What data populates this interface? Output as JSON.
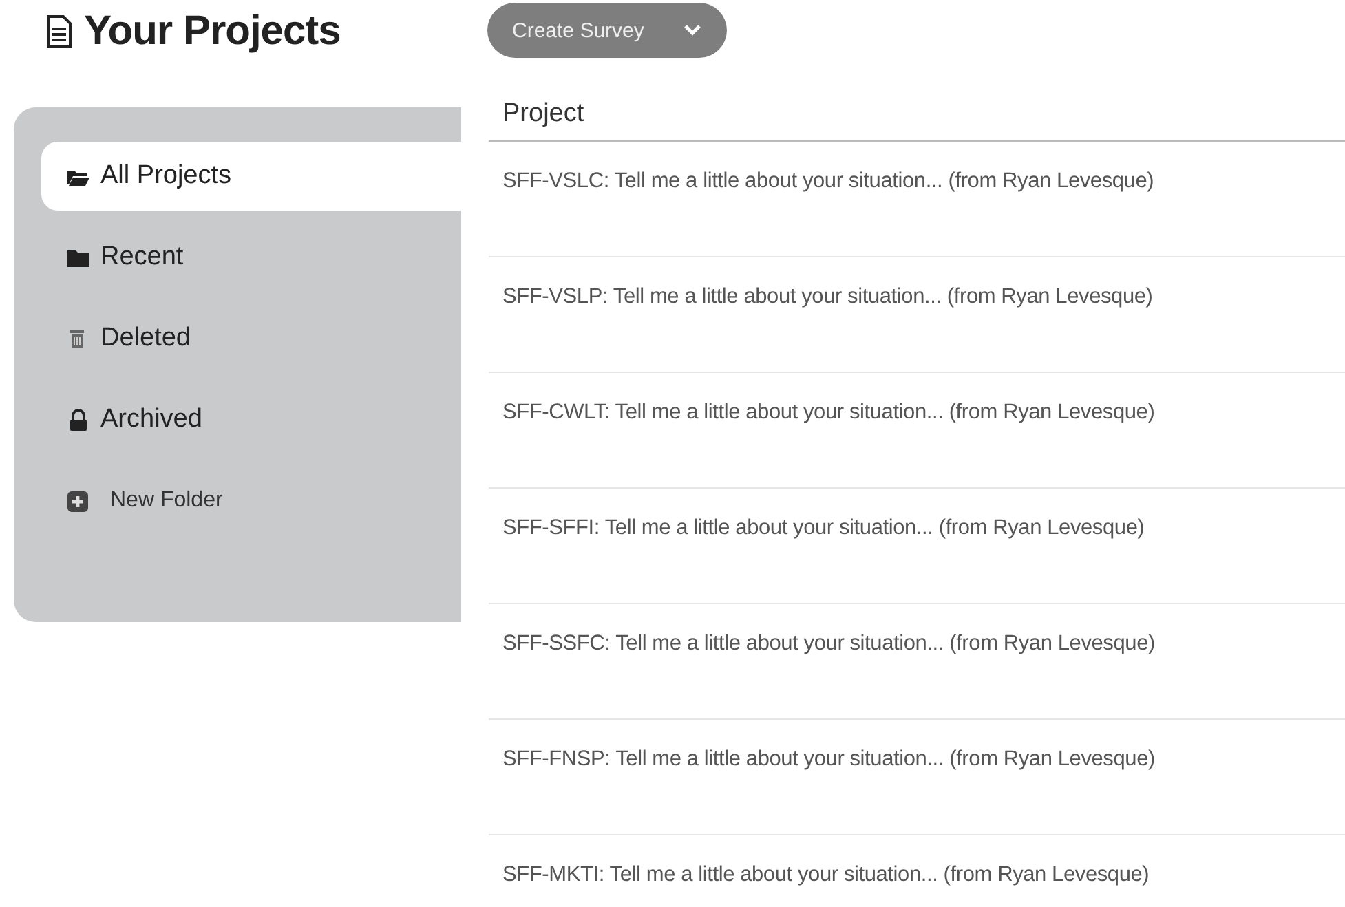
{
  "header": {
    "title": "Your Projects",
    "create_button": "Create Survey"
  },
  "sidebar": {
    "items": [
      {
        "label": "All Projects",
        "kind": "folder",
        "selected": true
      },
      {
        "label": "Recent",
        "kind": "folder",
        "selected": false
      },
      {
        "label": "Deleted",
        "kind": "folder",
        "selected": false
      },
      {
        "label": "Archived",
        "kind": "folder",
        "selected": false
      },
      {
        "label": "New Folder",
        "kind": "action",
        "selected": false
      }
    ]
  },
  "table": {
    "columns": [
      "Project"
    ],
    "rows": [
      "SFF-VSLC: Tell me a little about your situation... (from Ryan Levesque)",
      "SFF-VSLP: Tell me a little about your situation... (from Ryan Levesque)",
      "SFF-CWLT: Tell me a little about your situation... (from Ryan Levesque)",
      "SFF-SFFI: Tell me a little about your situation... (from Ryan Levesque)",
      "SFF-SSFC: Tell me a little about your situation... (from Ryan Levesque)",
      "SFF-FNSP: Tell me a little about your situation... (from Ryan Levesque)",
      "SFF-MKTI: Tell me a little about your situation... (from Ryan Levesque)"
    ]
  }
}
